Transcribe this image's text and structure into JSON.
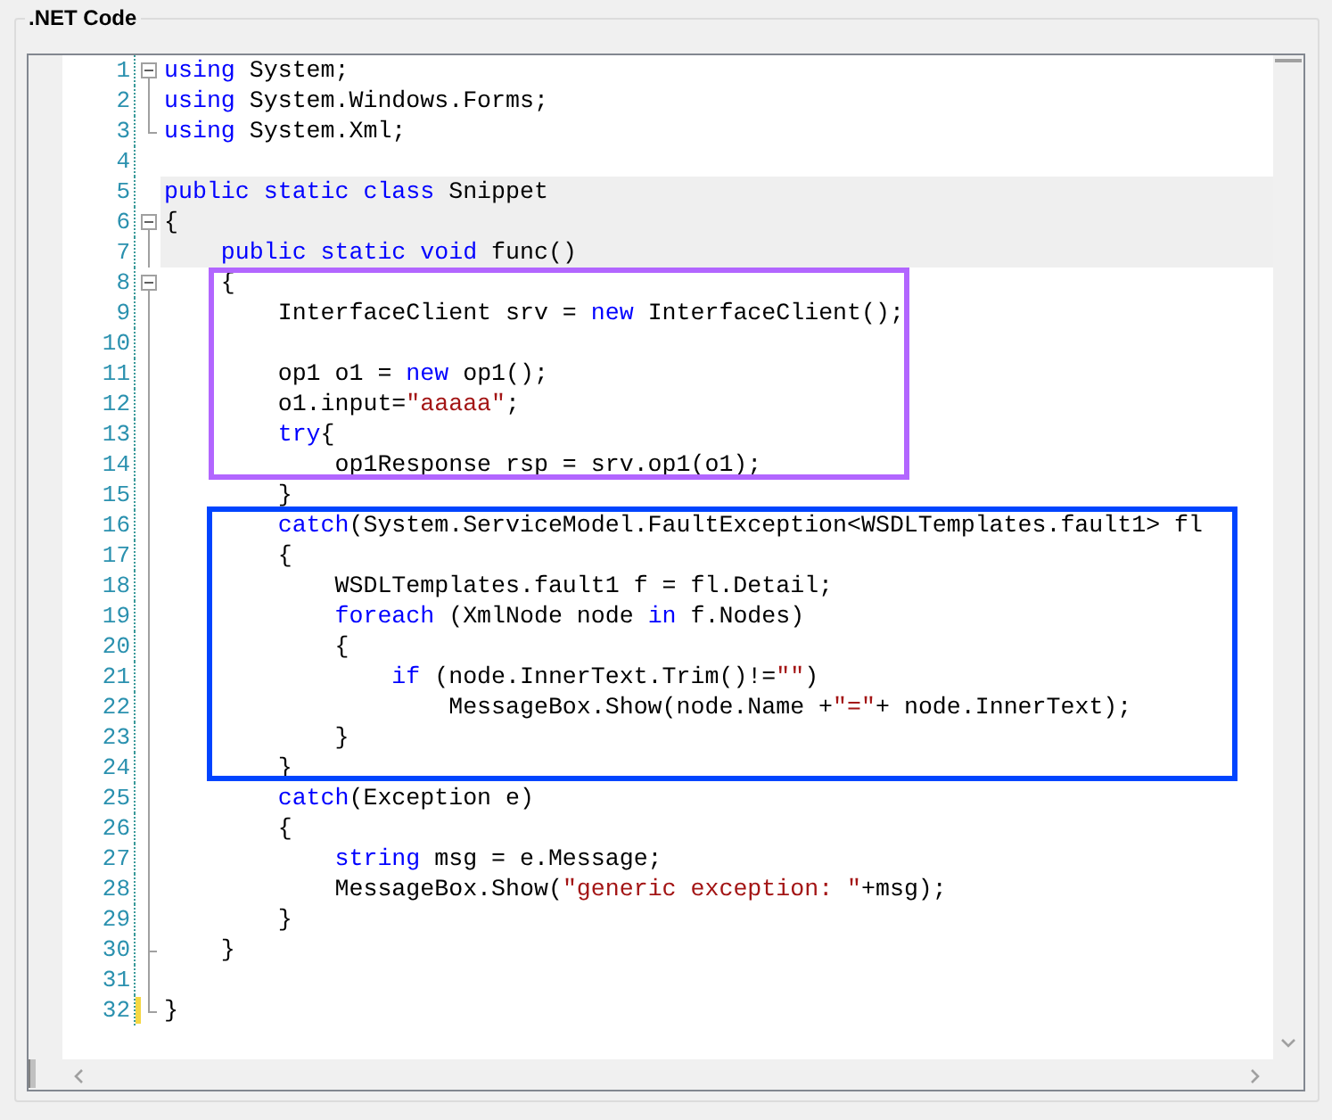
{
  "group_title": ".NET Code",
  "lines": [
    {
      "number": "1",
      "kind": "fold-start",
      "highlighted": false,
      "changed": false,
      "tokens": [
        {
          "kind": "keyword",
          "text": "using"
        },
        {
          "kind": "plain",
          "text": " System;"
        }
      ]
    },
    {
      "number": "2",
      "kind": "fold-body",
      "highlighted": false,
      "changed": false,
      "tokens": [
        {
          "kind": "keyword",
          "text": "using"
        },
        {
          "kind": "plain",
          "text": " System.Windows.Forms;"
        }
      ]
    },
    {
      "number": "3",
      "kind": "fold-end",
      "highlighted": false,
      "changed": false,
      "tokens": [
        {
          "kind": "keyword",
          "text": "using"
        },
        {
          "kind": "plain",
          "text": " System.Xml;"
        }
      ]
    },
    {
      "number": "4",
      "kind": "plain",
      "highlighted": false,
      "changed": false
    },
    {
      "number": "5",
      "kind": "plain",
      "highlighted": true,
      "changed": false,
      "tokens": [
        {
          "kind": "keyword",
          "text": "public static class"
        },
        {
          "kind": "plain",
          "text": " Snippet"
        }
      ]
    },
    {
      "number": "6",
      "kind": "fold-start",
      "highlighted": true,
      "changed": false,
      "tokens": [
        {
          "kind": "plain",
          "text": "{"
        }
      ]
    },
    {
      "number": "7",
      "kind": "fold-body",
      "highlighted": true,
      "changed": false,
      "tokens": [
        {
          "kind": "keyword",
          "text": "    public static void"
        },
        {
          "kind": "plain",
          "text": " func()"
        }
      ]
    },
    {
      "number": "8",
      "kind": "fold-start",
      "highlighted": false,
      "changed": false,
      "tokens": [
        {
          "kind": "plain",
          "text": "    {"
        }
      ]
    },
    {
      "number": "9",
      "kind": "fold-body",
      "highlighted": false,
      "changed": false,
      "tokens": [
        {
          "kind": "plain",
          "text": "        InterfaceClient srv = "
        },
        {
          "kind": "keyword",
          "text": "new"
        },
        {
          "kind": "plain",
          "text": " InterfaceClient();"
        }
      ]
    },
    {
      "number": "10",
      "kind": "fold-body",
      "highlighted": false,
      "changed": false
    },
    {
      "number": "11",
      "kind": "fold-body",
      "highlighted": false,
      "changed": false,
      "tokens": [
        {
          "kind": "plain",
          "text": "        op1 o1 = "
        },
        {
          "kind": "keyword",
          "text": "new"
        },
        {
          "kind": "plain",
          "text": " op1();"
        }
      ]
    },
    {
      "number": "12",
      "kind": "fold-body",
      "highlighted": false,
      "changed": false,
      "tokens": [
        {
          "kind": "plain",
          "text": "        o1.input="
        },
        {
          "kind": "string",
          "text": "\"aaaaa\""
        },
        {
          "kind": "plain",
          "text": ";"
        }
      ]
    },
    {
      "number": "13",
      "kind": "fold-body",
      "highlighted": false,
      "changed": false,
      "tokens": [
        {
          "kind": "keyword",
          "text": "        try"
        },
        {
          "kind": "plain",
          "text": "{"
        }
      ]
    },
    {
      "number": "14",
      "kind": "fold-body",
      "highlighted": false,
      "changed": false,
      "tokens": [
        {
          "kind": "plain",
          "text": "            op1Response rsp = srv.op1(o1);"
        }
      ]
    },
    {
      "number": "15",
      "kind": "fold-body",
      "highlighted": false,
      "changed": false,
      "tokens": [
        {
          "kind": "plain",
          "text": "        }"
        }
      ]
    },
    {
      "number": "16",
      "kind": "fold-body",
      "highlighted": false,
      "changed": false,
      "tokens": [
        {
          "kind": "keyword",
          "text": "        catch"
        },
        {
          "kind": "plain",
          "text": "(System.ServiceModel.FaultException<WSDLTemplates.fault1> fl"
        }
      ]
    },
    {
      "number": "17",
      "kind": "fold-body",
      "highlighted": false,
      "changed": false,
      "tokens": [
        {
          "kind": "plain",
          "text": "        {"
        }
      ]
    },
    {
      "number": "18",
      "kind": "fold-body",
      "highlighted": false,
      "changed": false,
      "tokens": [
        {
          "kind": "plain",
          "text": "            WSDLTemplates.fault1 f = fl.Detail;"
        }
      ]
    },
    {
      "number": "19",
      "kind": "fold-body",
      "highlighted": false,
      "changed": false,
      "tokens": [
        {
          "kind": "keyword",
          "text": "            foreach"
        },
        {
          "kind": "plain",
          "text": " (XmlNode node "
        },
        {
          "kind": "keyword",
          "text": "in"
        },
        {
          "kind": "plain",
          "text": " f.Nodes)"
        }
      ]
    },
    {
      "number": "20",
      "kind": "fold-body",
      "highlighted": false,
      "changed": false,
      "tokens": [
        {
          "kind": "plain",
          "text": "            {"
        }
      ]
    },
    {
      "number": "21",
      "kind": "fold-body",
      "highlighted": false,
      "changed": false,
      "tokens": [
        {
          "kind": "keyword",
          "text": "                if"
        },
        {
          "kind": "plain",
          "text": " (node.InnerText.Trim()!="
        },
        {
          "kind": "string",
          "text": "\"\""
        },
        {
          "kind": "plain",
          "text": ")"
        }
      ]
    },
    {
      "number": "22",
      "kind": "fold-body",
      "highlighted": false,
      "changed": false,
      "tokens": [
        {
          "kind": "plain",
          "text": "                    MessageBox.Show(node.Name +"
        },
        {
          "kind": "string",
          "text": "\"=\""
        },
        {
          "kind": "plain",
          "text": "+ node.InnerText);"
        }
      ]
    },
    {
      "number": "23",
      "kind": "fold-body",
      "highlighted": false,
      "changed": false,
      "tokens": [
        {
          "kind": "plain",
          "text": "            }"
        }
      ]
    },
    {
      "number": "24",
      "kind": "fold-body",
      "highlighted": false,
      "changed": false,
      "tokens": [
        {
          "kind": "plain",
          "text": "        }"
        }
      ]
    },
    {
      "number": "25",
      "kind": "fold-body",
      "highlighted": false,
      "changed": false,
      "tokens": [
        {
          "kind": "keyword",
          "text": "        catch"
        },
        {
          "kind": "plain",
          "text": "(Exception e)"
        }
      ]
    },
    {
      "number": "26",
      "kind": "fold-body",
      "highlighted": false,
      "changed": false,
      "tokens": [
        {
          "kind": "plain",
          "text": "        {"
        }
      ]
    },
    {
      "number": "27",
      "kind": "fold-body",
      "highlighted": false,
      "changed": false,
      "tokens": [
        {
          "kind": "keyword",
          "text": "            string"
        },
        {
          "kind": "plain",
          "text": " msg = e.Message;"
        }
      ]
    },
    {
      "number": "28",
      "kind": "fold-body",
      "highlighted": false,
      "changed": false,
      "tokens": [
        {
          "kind": "plain",
          "text": "            MessageBox.Show("
        },
        {
          "kind": "string",
          "text": "\"generic exception: \""
        },
        {
          "kind": "plain",
          "text": "+msg);"
        }
      ]
    },
    {
      "number": "29",
      "kind": "fold-body",
      "highlighted": false,
      "changed": false,
      "tokens": [
        {
          "kind": "plain",
          "text": "        }"
        }
      ]
    },
    {
      "number": "30",
      "kind": "fold-tick",
      "highlighted": false,
      "changed": false,
      "tokens": [
        {
          "kind": "plain",
          "text": "    }"
        }
      ]
    },
    {
      "number": "31",
      "kind": "fold-body",
      "highlighted": false,
      "changed": false
    },
    {
      "number": "32",
      "kind": "fold-end",
      "highlighted": false,
      "changed": true,
      "tokens": [
        {
          "kind": "plain",
          "text": "}"
        }
      ]
    }
  ],
  "annotations": [
    {
      "color": "#b266ff"
    },
    {
      "color": "#0044ff"
    }
  ]
}
